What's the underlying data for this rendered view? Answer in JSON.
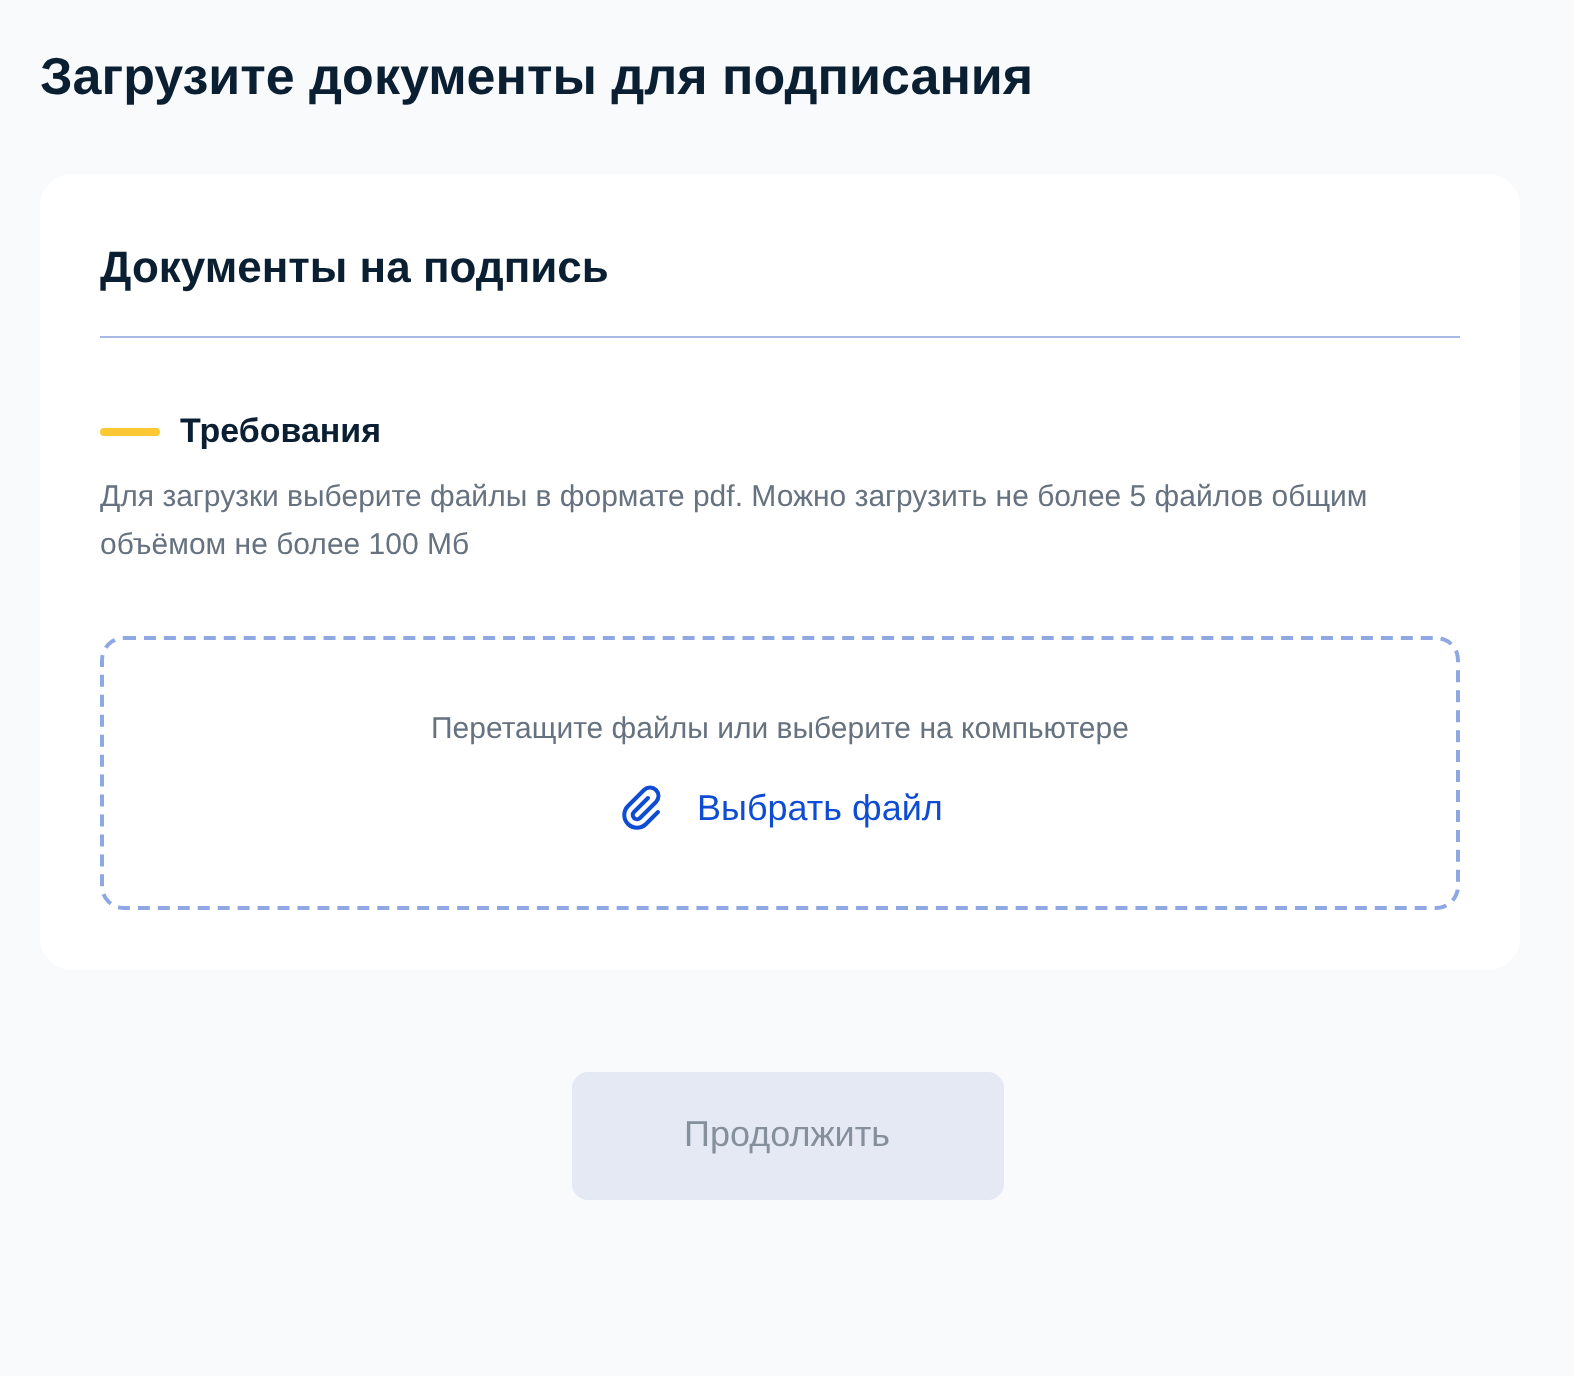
{
  "page_title": "Загрузите документы для подписания",
  "card": {
    "title": "Документы на подпись",
    "requirements": {
      "title": "Требования",
      "text": "Для загрузки выберите файлы в формате pdf. Можно загрузить не более 5 файлов общим объёмом не более 100 Мб"
    },
    "dropzone": {
      "hint": "Перетащите файлы или выберите на компьютере",
      "link": "Выбрать файл"
    }
  },
  "continue_button": {
    "label": "Продолжить",
    "disabled": true
  }
}
